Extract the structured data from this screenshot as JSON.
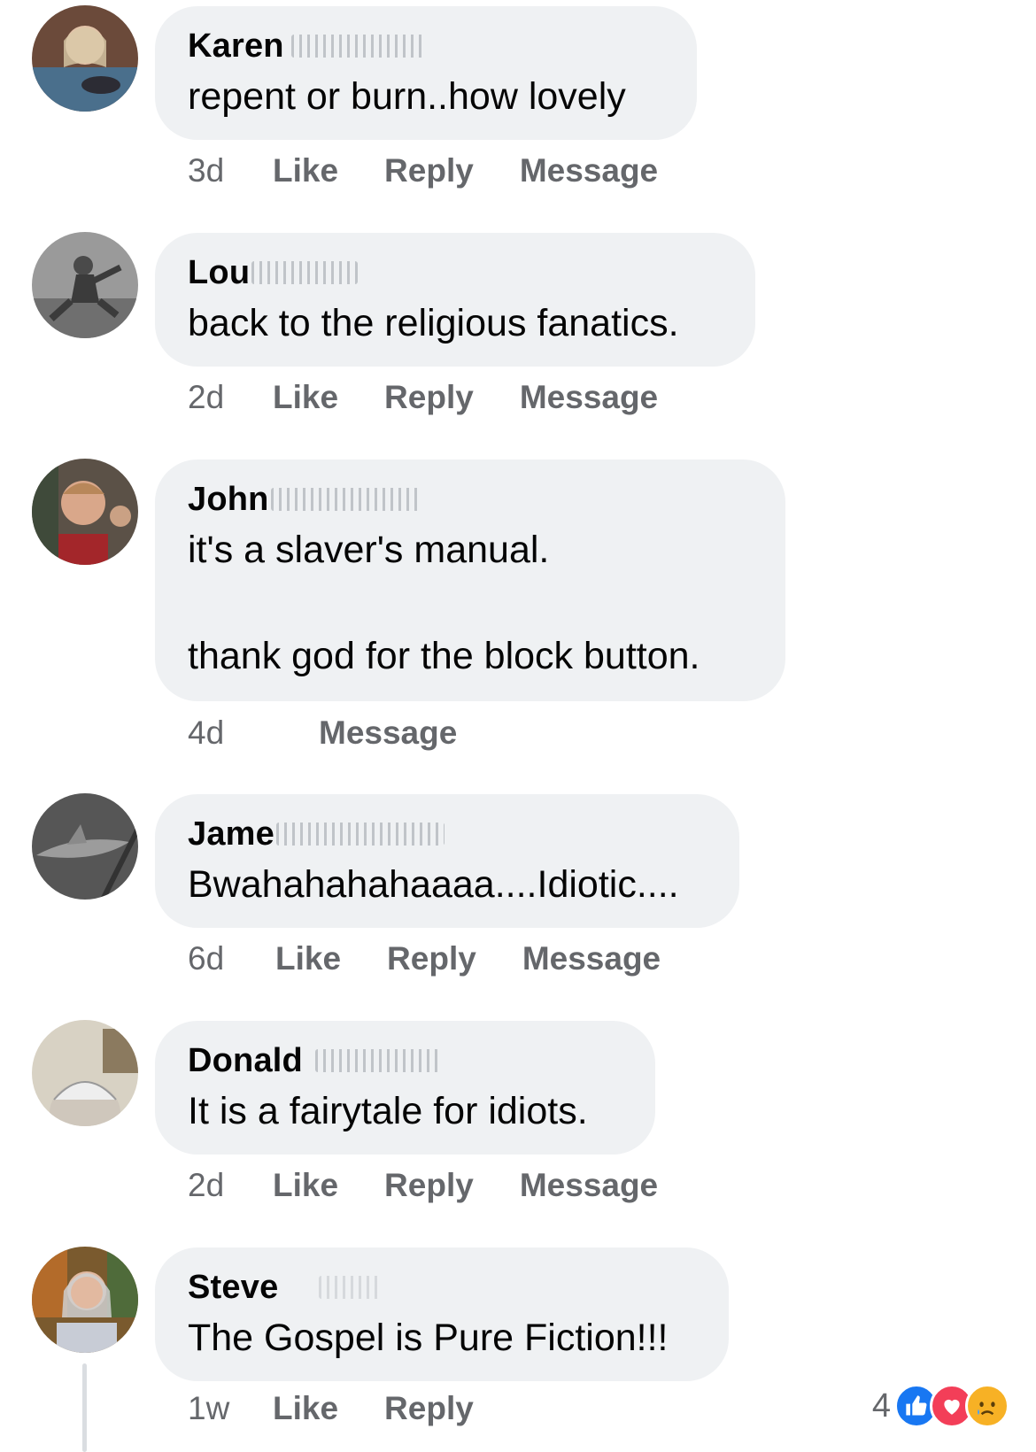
{
  "comments": [
    {
      "author": "Karen",
      "text": "repent or burn..how lovely",
      "time": "3d",
      "actions": [
        "Like",
        "Reply",
        "Message"
      ]
    },
    {
      "author": "Lou",
      "text": "back to the religious fanatics.",
      "time": "2d",
      "actions": [
        "Like",
        "Reply",
        "Message"
      ]
    },
    {
      "author": "John",
      "text": "it's a slaver's manual.\n\nthank god for the block button.",
      "time": "4d",
      "actions": [
        "Message"
      ]
    },
    {
      "author": "Jame",
      "text": "Bwahahahahaaaa....Idiotic....",
      "time": "6d",
      "actions": [
        "Like",
        "Reply",
        "Message"
      ]
    },
    {
      "author": "Donald",
      "text": "It is a fairytale for idiots.",
      "time": "2d",
      "actions": [
        "Like",
        "Reply",
        "Message"
      ]
    },
    {
      "author": "Steve",
      "text": "The Gospel is Pure Fiction!!!",
      "time": "1w",
      "actions": [
        "Like",
        "Reply"
      ]
    }
  ],
  "reactions": {
    "count": "4",
    "icons": [
      "like-icon",
      "love-icon",
      "sad-icon"
    ],
    "colors": {
      "like": "#1877f2",
      "love": "#f33e58",
      "sad": "#f7b125"
    }
  }
}
